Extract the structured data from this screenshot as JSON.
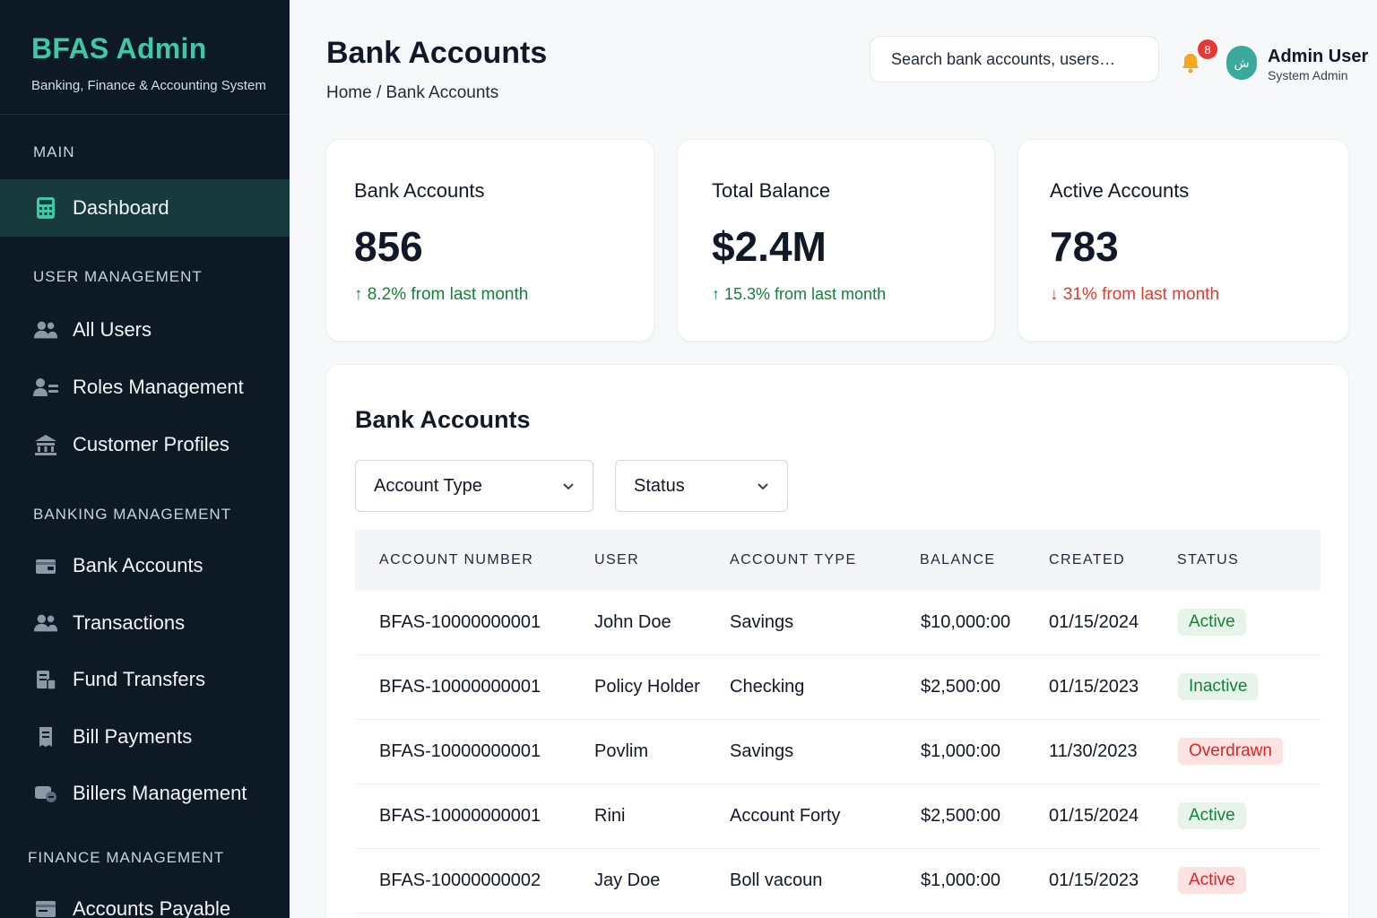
{
  "sidebar": {
    "brand_title": "BFAS Admin",
    "brand_subtitle": "Banking, Finance & Accounting System",
    "sections": {
      "main": "MAIN",
      "user_management": "USER MANAGEMENT",
      "banking_management": "BANKING MANAGEMENT",
      "finance_management": "FINANCE MANAGEMENT"
    },
    "items": [
      {
        "label": "Dashboard",
        "icon": "calculator-icon"
      },
      {
        "label": "All Users",
        "icon": "users-icon"
      },
      {
        "label": "Roles Management",
        "icon": "user-roles-icon"
      },
      {
        "label": "Customer Profiles",
        "icon": "bank-building-icon"
      },
      {
        "label": "Bank Accounts",
        "icon": "wallet-icon"
      },
      {
        "label": "Transactions",
        "icon": "users-icon"
      },
      {
        "label": "Fund Transfers",
        "icon": "transfer-icon"
      },
      {
        "label": "Bill Payments",
        "icon": "receipt-icon"
      },
      {
        "label": "Billers Management",
        "icon": "biller-icon"
      },
      {
        "label": "Accounts Payable",
        "icon": "ledger-icon"
      }
    ]
  },
  "header": {
    "title": "Bank Accounts",
    "breadcrumb": "Home / Bank Accounts",
    "search_placeholder": "Search bank accounts, users…",
    "notification_count": "8",
    "avatar_initial": "ش",
    "user_name": "Admin User",
    "user_role": "System Admin"
  },
  "stats": [
    {
      "title": "Bank Accounts",
      "value": "856",
      "trend": "↑ 8.2% from last month",
      "direction": "up"
    },
    {
      "title": "Total Balance",
      "value": "$2.4M",
      "trend": "↑ 15.3% from last month",
      "direction": "up"
    },
    {
      "title": "Active Accounts",
      "value": "783",
      "trend": "↓ 31% from last month",
      "direction": "down"
    }
  ],
  "panel": {
    "title": "Bank Accounts",
    "filters": {
      "account_type": "Account Type",
      "status": "Status"
    },
    "columns": [
      "ACCOUNT NUMBER",
      "USER",
      "ACCOUNT TYPE",
      "BALANCE",
      "CREATED",
      "STATUS"
    ],
    "rows": [
      {
        "account": "BFAS-10000000001",
        "user": "John Doe",
        "type": "Savings",
        "balance": "$10,000:00",
        "created": "01/15/2024",
        "status": "Active",
        "status_color": "green"
      },
      {
        "account": "BFAS-10000000001",
        "user": "Policy Holder",
        "type": "Checking",
        "balance": "$2,500:00",
        "created": "01/15/2023",
        "status": "Inactive",
        "status_color": "green"
      },
      {
        "account": "BFAS-10000000001",
        "user": "Povlim",
        "type": "Savings",
        "balance": "$1,000:00",
        "created": "11/30/2023",
        "status": "Overdrawn",
        "status_color": "red"
      },
      {
        "account": "BFAS-10000000001",
        "user": "Rini",
        "type": "Account Forty",
        "balance": "$2,500:00",
        "created": "01/15/2024",
        "status": "Active",
        "status_color": "green"
      },
      {
        "account": "BFAS-10000000002",
        "user": "Jay Doe",
        "type": "Boll vacoun",
        "balance": "$1,000:00",
        "created": "01/15/2023",
        "status": "Active",
        "status_color": "red"
      }
    ]
  },
  "colors": {
    "sidebar_bg": "#0d1a26",
    "brand_accent": "#3fc7a6",
    "active_nav_bg": "#173a3c",
    "trend_up": "#15803d",
    "trend_down": "#e03b2f"
  }
}
